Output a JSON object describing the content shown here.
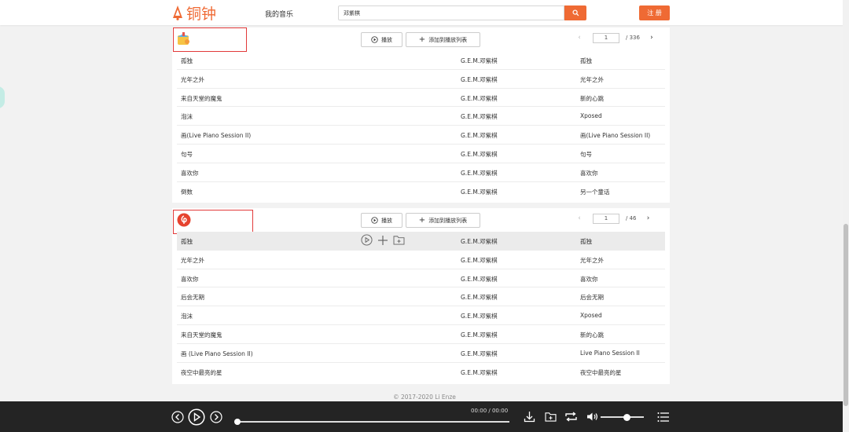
{
  "header": {
    "logo_text": "铜钟",
    "nav_my_music": "我的音乐",
    "search": {
      "value": "邓紫棋",
      "placeholder": ""
    },
    "register_label": "注 册"
  },
  "panels": [
    {
      "source_icon": "qq-music-icon",
      "play_label": "播放",
      "add_label": "添加到播放列表",
      "page": "1",
      "total_pages": "/ 336",
      "rows": [
        {
          "title": "孤独",
          "artist": "G.E.M.邓紫棋",
          "album": "孤独"
        },
        {
          "title": "光年之外",
          "artist": "G.E.M.邓紫棋",
          "album": "光年之外"
        },
        {
          "title": "来自天堂的魔鬼",
          "artist": "G.E.M.邓紫棋",
          "album": "新的心跳"
        },
        {
          "title": "泡沫",
          "artist": "G.E.M.邓紫棋",
          "album": "Xposed"
        },
        {
          "title": "画(Live Piano Session II)",
          "artist": "G.E.M.邓紫棋",
          "album": "画(Live Piano Session II)"
        },
        {
          "title": "句号",
          "artist": "G.E.M.邓紫棋",
          "album": "句号"
        },
        {
          "title": "喜欢你",
          "artist": "G.E.M.邓紫棋",
          "album": "喜欢你"
        },
        {
          "title": "倒数",
          "artist": "G.E.M.邓紫棋",
          "album": "另一个童话"
        }
      ]
    },
    {
      "source_icon": "netease-music-icon",
      "play_label": "播放",
      "add_label": "添加到播放列表",
      "page": "1",
      "total_pages": "/ 46",
      "rows": [
        {
          "title": "孤独",
          "artist": "G.E.M.邓紫棋",
          "album": "孤独"
        },
        {
          "title": "光年之外",
          "artist": "G.E.M.邓紫棋",
          "album": "光年之外"
        },
        {
          "title": "喜欢你",
          "artist": "G.E.M.邓紫棋",
          "album": "喜欢你"
        },
        {
          "title": "后会无期",
          "artist": "G.E.M.邓紫棋",
          "album": "后会无期"
        },
        {
          "title": "泡沫",
          "artist": "G.E.M.邓紫棋",
          "album": "Xposed"
        },
        {
          "title": "来自天堂的魔鬼",
          "artist": "G.E.M.邓紫棋",
          "album": "新的心跳"
        },
        {
          "title": "画 (Live Piano Session II)",
          "artist": "G.E.M.邓紫棋",
          "album": "Live Piano Session II"
        },
        {
          "title": "夜空中最亮的星",
          "artist": "G.E.M.邓紫棋",
          "album": "夜空中最亮的星"
        }
      ]
    }
  ],
  "footer": {
    "copyright": "© 2017-2020   Li Enze"
  },
  "player": {
    "time": "00:00 / 00:00",
    "progress_fraction": 0,
    "volume_fraction": 0.6
  },
  "colors": {
    "accent": "#ef6a34",
    "highlight_box": "#e23a3a"
  }
}
